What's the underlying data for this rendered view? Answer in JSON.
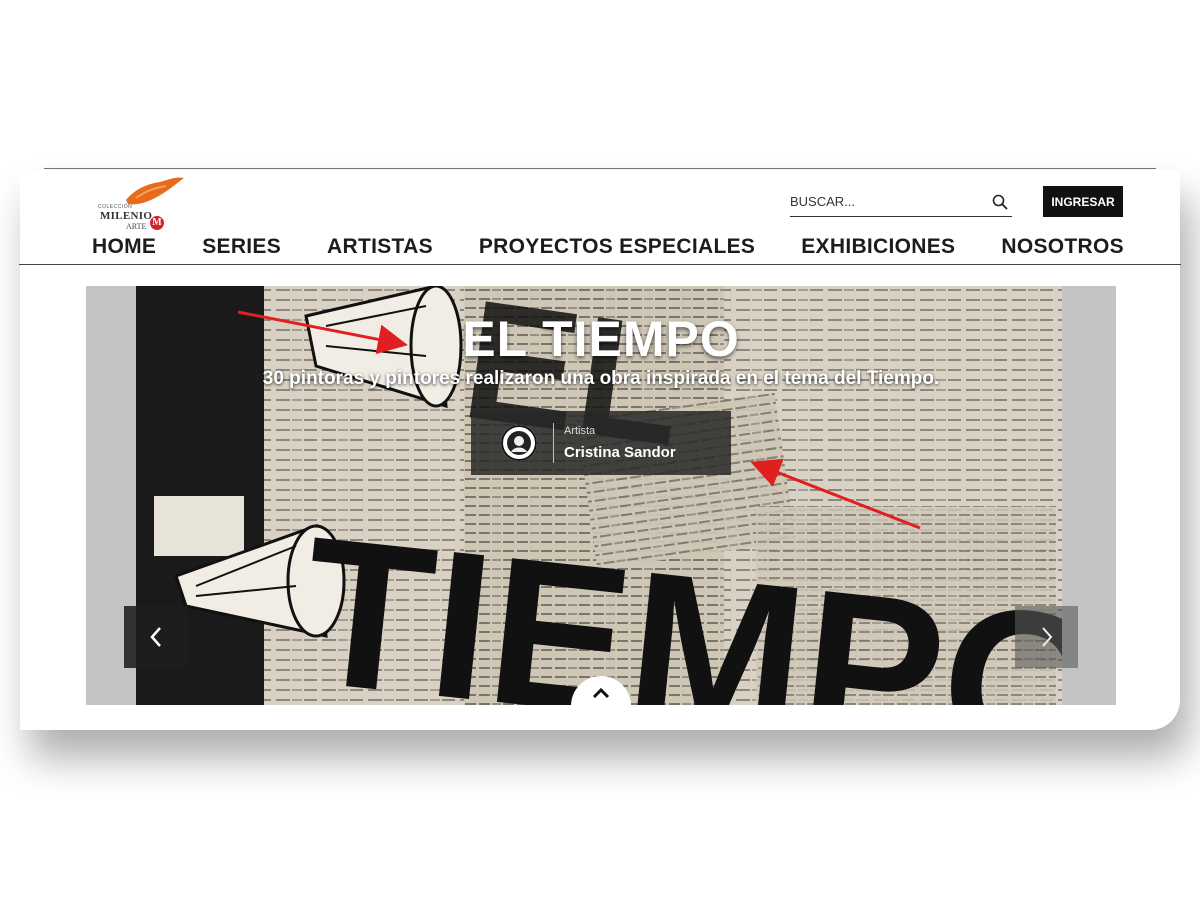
{
  "brand": {
    "logo_small": "COLECCIÓN",
    "logo_main": "MILENIO",
    "logo_sub": "ARTE",
    "logo_badge": "M",
    "accent_color": "#e86a1a",
    "badge_color": "#d8232a"
  },
  "search": {
    "placeholder": "BUSCAR...",
    "icon": "search-icon"
  },
  "login": {
    "label": "INGRESAR"
  },
  "nav": {
    "items": [
      {
        "label": "HOME"
      },
      {
        "label": "SERIES"
      },
      {
        "label": "ARTISTAS"
      },
      {
        "label": "PROYECTOS ESPECIALES"
      },
      {
        "label": "EXHIBICIONES"
      },
      {
        "label": "NOSOTROS"
      }
    ]
  },
  "hero": {
    "title": "EL TIEMPO",
    "subtitle": "30 pintoras y pintores realizaron una obra inspirada en el tema del Tiempo.",
    "artist_role": "Artista",
    "artist_name": "Cristina Sandor",
    "artwork_text_top": "EL",
    "artwork_text_bottom": "TIEMPO",
    "prev_icon": "chevron-left-icon",
    "next_icon": "chevron-right-icon",
    "scroll_icon": "chevron-up-icon"
  },
  "annotations": {
    "arrow_color": "#e02020"
  }
}
